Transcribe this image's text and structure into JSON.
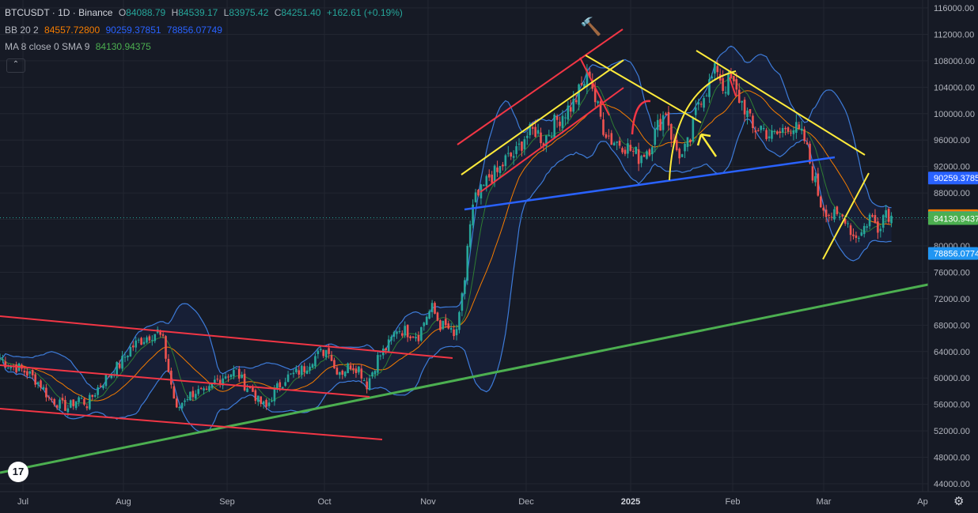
{
  "header": {
    "symbol": "BTCUSDT · 1D · Binance",
    "o_label": "O",
    "o_value": "84088.79",
    "h_label": "H",
    "h_value": "84539.17",
    "l_label": "L",
    "l_value": "83975.42",
    "c_label": "C",
    "c_value": "84251.40",
    "change": "+162.61 (+0.19%)"
  },
  "indicators": {
    "bb_label": "BB 20 2",
    "bb_basis": "84557.72800",
    "bb_upper": "90259.37851",
    "bb_lower": "78856.07749",
    "ma_label": "MA 8 close 0 SMA 9",
    "ma_value": "84130.94375"
  },
  "collapse_icon": "chevron-up-icon",
  "colors": {
    "bg": "#161a25",
    "grid": "#222631",
    "up": "#26a69a",
    "down": "#ef5350",
    "bb": "#2962ff",
    "bb_band": "#5b9bd5",
    "ma_fast": "#2e7d32",
    "ma_slow": "#f57c00",
    "trend_red": "#f23645",
    "trend_yellow": "#ffeb3b",
    "trend_blue": "#2962ff",
    "trend_green": "#4caf50",
    "lbl_upper": "#2962ff",
    "lbl_basis": "#f57c00",
    "lbl_close": "#26a69a",
    "lbl_ma": "#4caf50",
    "lbl_lower": "#2196f3"
  },
  "chart_data": {
    "type": "candlestick",
    "symbol": "BTCUSDT",
    "interval": "1D",
    "exchange": "Binance",
    "y_axis_ticks": [
      "116000.00",
      "112000.00",
      "108000.00",
      "104000.00",
      "100000.00",
      "96000.00",
      "92000.00",
      "88000.00",
      "84000.00",
      "80000.00",
      "76000.00",
      "72000.00",
      "68000.00",
      "64000.00",
      "60000.00",
      "56000.00",
      "52000.00",
      "48000.00",
      "44000.00"
    ],
    "x_axis_labels": [
      "Jul",
      "Aug",
      "Sep",
      "Oct",
      "Nov",
      "Dec",
      "2025",
      "Feb",
      "Mar",
      "Ap"
    ],
    "ylim": [
      42000,
      117500
    ],
    "price_labels": [
      {
        "name": "BB upper",
        "value": "90259.3785",
        "level": 90259,
        "color": "#2962ff"
      },
      {
        "name": "BB basis",
        "value": "84557.7280",
        "level": 84558,
        "color": "#f57c00"
      },
      {
        "name": "Close",
        "value": "84251.40",
        "level": 84251,
        "color": "#26a69a"
      },
      {
        "name": "MA",
        "value": "84130.9437",
        "level": 84131,
        "color": "#4caf50"
      },
      {
        "name": "BB lower",
        "value": "78856.0774",
        "level": 78856,
        "color": "#2196f3"
      }
    ],
    "price_series_approx": [
      [
        1,
        63000
      ],
      [
        4,
        62000
      ],
      [
        8,
        61500
      ],
      [
        12,
        60500
      ],
      [
        16,
        59000
      ],
      [
        19,
        57000
      ],
      [
        23,
        56000
      ],
      [
        26,
        55500
      ],
      [
        30,
        57000
      ],
      [
        33,
        56000
      ],
      [
        37,
        58500
      ],
      [
        41,
        60500
      ],
      [
        45,
        62000
      ],
      [
        49,
        64500
      ],
      [
        52,
        65500
      ],
      [
        56,
        66500
      ],
      [
        59,
        67000
      ],
      [
        61,
        65500
      ],
      [
        63,
        61000
      ],
      [
        66,
        55000
      ],
      [
        69,
        57000
      ],
      [
        73,
        58000
      ],
      [
        77,
        57500
      ],
      [
        80,
        59500
      ],
      [
        84,
        60500
      ],
      [
        88,
        61000
      ],
      [
        91,
        59000
      ],
      [
        94,
        58000
      ],
      [
        96,
        56500
      ],
      [
        99,
        55500
      ],
      [
        102,
        58000
      ],
      [
        106,
        60000
      ],
      [
        109,
        60500
      ],
      [
        113,
        61500
      ],
      [
        116,
        63000
      ],
      [
        120,
        64000
      ],
      [
        122,
        64500
      ],
      [
        124,
        61500
      ],
      [
        127,
        61000
      ],
      [
        130,
        62000
      ],
      [
        133,
        61500
      ],
      [
        136,
        59000
      ],
      [
        140,
        63000
      ],
      [
        144,
        65000
      ],
      [
        147,
        67500
      ],
      [
        151,
        67000
      ],
      [
        155,
        66500
      ],
      [
        158,
        69500
      ],
      [
        160,
        70500
      ],
      [
        163,
        68000
      ],
      [
        166,
        67500
      ],
      [
        168,
        66000
      ],
      [
        170,
        69000
      ],
      [
        171,
        72000
      ],
      [
        172,
        75000
      ],
      [
        173,
        80000
      ],
      [
        175,
        85500
      ],
      [
        176,
        87000
      ],
      [
        178,
        88000
      ],
      [
        181,
        90500
      ],
      [
        184,
        91000
      ],
      [
        187,
        93000
      ],
      [
        191,
        94000
      ],
      [
        194,
        96500
      ],
      [
        198,
        97500
      ],
      [
        201,
        96000
      ],
      [
        205,
        98500
      ],
      [
        208,
        100000
      ],
      [
        212,
        101500
      ],
      [
        215,
        104000
      ],
      [
        218,
        106500
      ],
      [
        220,
        102000
      ],
      [
        223,
        98000
      ],
      [
        226,
        96000
      ],
      [
        230,
        95500
      ],
      [
        233,
        94500
      ],
      [
        236,
        93500
      ],
      [
        240,
        95000
      ],
      [
        243,
        98000
      ],
      [
        246,
        100500
      ],
      [
        249,
        95000
      ],
      [
        252,
        93500
      ],
      [
        255,
        96000
      ],
      [
        258,
        102000
      ],
      [
        262,
        104500
      ],
      [
        265,
        107000
      ],
      [
        267,
        104000
      ],
      [
        270,
        105000
      ],
      [
        272,
        103000
      ],
      [
        275,
        101000
      ],
      [
        278,
        97500
      ],
      [
        281,
        98000
      ],
      [
        285,
        96500
      ],
      [
        288,
        97000
      ],
      [
        291,
        98500
      ],
      [
        294,
        97500
      ],
      [
        297,
        96000
      ],
      [
        300,
        91000
      ],
      [
        303,
        86500
      ],
      [
        306,
        85000
      ],
      [
        309,
        84000
      ],
      [
        312,
        84500
      ],
      [
        315,
        81500
      ],
      [
        318,
        82000
      ],
      [
        321,
        84500
      ],
      [
        324,
        83000
      ],
      [
        327,
        85500
      ],
      [
        329,
        84251
      ]
    ],
    "annotations": [
      "red rising channel (Nov–Dec)",
      "yellow converging lines",
      "blue support line",
      "green long-term trendline",
      "red descending channel (Jul–Oct)",
      "yellow arrows",
      "hammer emoji"
    ]
  }
}
